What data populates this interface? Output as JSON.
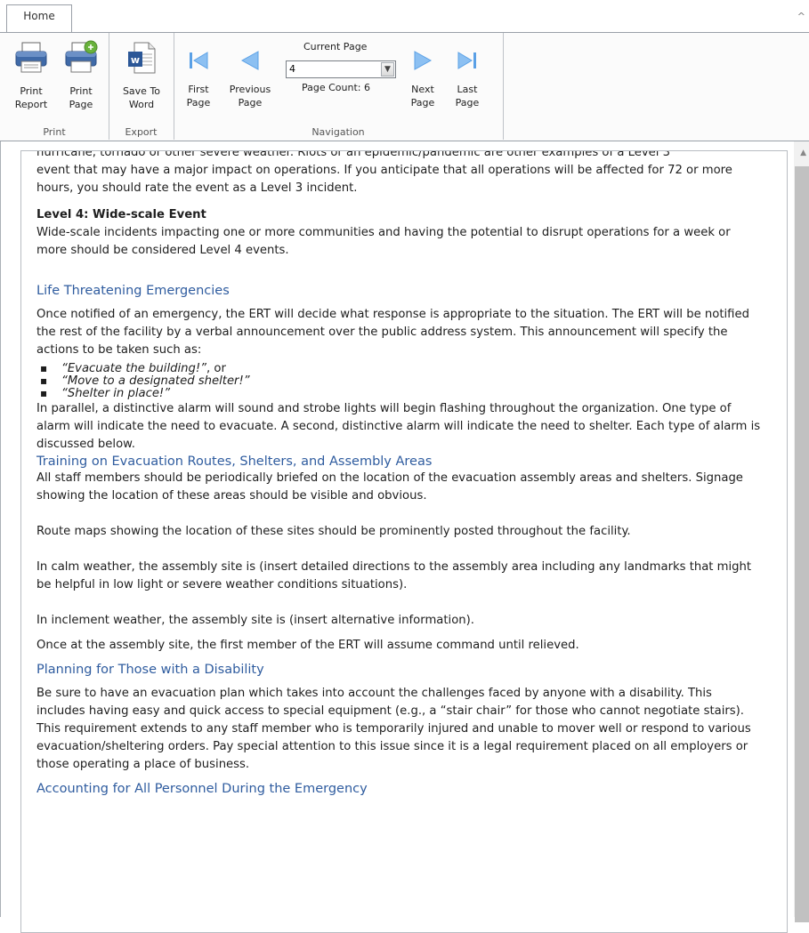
{
  "ribbon": {
    "tab": "Home",
    "groups": {
      "print": {
        "label": "Print",
        "print_report": "Print\nReport",
        "print_page": "Print\nPage"
      },
      "export": {
        "label": "Export",
        "save_to_word": "Save To\nWord"
      },
      "navigation": {
        "label": "Navigation",
        "first_page": "First\nPage",
        "previous_page": "Previous\nPage",
        "current_page_label": "Current Page",
        "current_page_value": "4",
        "page_count": "Page Count: 6",
        "next_page": "Next\nPage",
        "last_page": "Last\nPage"
      }
    }
  },
  "document": {
    "partial_top": "hurricane, tornado or other severe weather. Riots or an epidemic/pandemic are other examples of a Level 3",
    "p1": "event that may have a major impact on operations. If you anticipate that all operations will be affected for 72 or more hours, you should rate the event as a Level 3 incident.",
    "level4_title": "Level 4: Wide-scale Event",
    "level4_text": "Wide-scale incidents impacting one or more communities and having the potential to disrupt operations for a week or more should be considered Level 4 events.",
    "h_life": "Life Threatening Emergencies",
    "life_text": "Once notified of an emergency, the ERT will decide what response is appropriate to the situation. The ERT will be notified the rest of the facility by a verbal announcement over the public address system. This announcement will specify the actions to be taken such as:",
    "bullets": [
      {
        "text": "“Evacuate the building!”",
        "suffix": ", or"
      },
      {
        "text": "“Move to a designated shelter!”",
        "suffix": ""
      },
      {
        "text": "“Shelter in place!”",
        "suffix": ""
      }
    ],
    "alarm_text": "In parallel, a distinctive alarm will sound and strobe lights will begin flashing throughout the organization. One type of alarm will indicate the need to evacuate. A second, distinctive alarm will indicate the need to shelter. Each type of alarm is discussed below.",
    "h_training": "Training on Evacuation Routes, Shelters, and Assembly Areas",
    "training_text": "All staff members should be periodically briefed on the location of the evacuation assembly areas and shelters. Signage showing the location of these areas should be visible and obvious.",
    "route_text": "Route maps showing the location of these sites should be prominently posted throughout the facility.",
    "calm_text": "In calm weather, the assembly site is (insert detailed directions to the assembly area including any landmarks that might be helpful in low light or severe weather conditions situations).",
    "inclement_text": "In inclement weather, the assembly site is (insert alternative information).",
    "once_text": "Once at the assembly site, the first member of the ERT will assume command until relieved.",
    "h_disability": "Planning for Those with a Disability",
    "disability_text": "Be sure to have an evacuation plan which takes into account the challenges faced by anyone with a disability. This includes having easy and quick access to special equipment (e.g., a “stair chair” for those who cannot negotiate stairs). This requirement extends to any staff member who is temporarily injured and unable to mover well or respond to various evacuation/sheltering orders. Pay special attention to this issue since it is a legal requirement placed on all employers or those operating a place of business.",
    "h_accounting": "Accounting for All Personnel During the Emergency"
  },
  "colors": {
    "heading": "#2f5c9f",
    "nav_arrow": "#5aa0e6"
  },
  "icons": [
    "printer-icon",
    "printer-page-icon",
    "word-document-icon",
    "first-page-icon",
    "previous-page-icon",
    "next-page-icon",
    "last-page-icon",
    "chevron-down-icon"
  ]
}
